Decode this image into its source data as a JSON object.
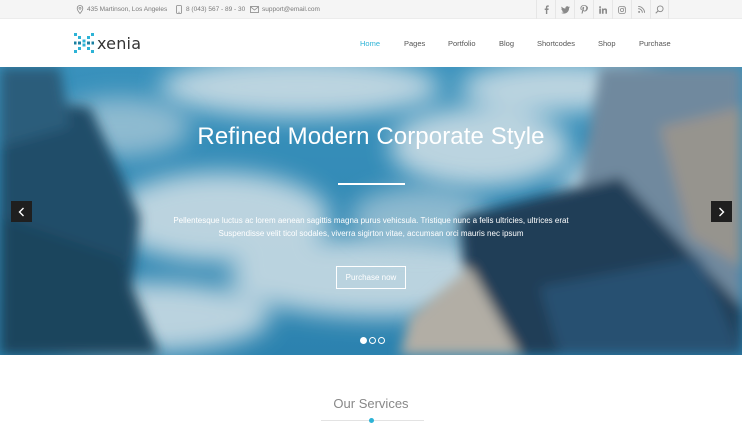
{
  "topbar": {
    "address": "435 Martinson, Los Angeles",
    "phone": "8 (043) 567 - 89 - 30",
    "email": "support@email.com",
    "social": [
      "facebook-icon",
      "twitter-icon",
      "pinterest-icon",
      "linkedin-icon",
      "instagram-icon",
      "rss-icon",
      "search-icon"
    ]
  },
  "header": {
    "logo": "xenia",
    "nav": [
      "Home",
      "Pages",
      "Portfolio",
      "Blog",
      "Shortcodes",
      "Shop",
      "Purchase"
    ],
    "active_nav": "Home"
  },
  "hero": {
    "title": "Refined Modern Corporate Style",
    "text_line1": "Pellentesque luctus ac lorem aenean sagittis magna purus vehicsula. Tristique nunc a felis ultricies, ultrices erat",
    "text_line2": "Suspendisse velit ticol sodales, viverra sigirton vitae, accumsan orci mauris nec ipsum",
    "button": "Purchase now",
    "slides_total": 3,
    "slide_active": 1
  },
  "services": {
    "title": "Our Services"
  },
  "colors": {
    "accent": "#2db3d6",
    "topbar_bg": "#f5f5f5"
  }
}
